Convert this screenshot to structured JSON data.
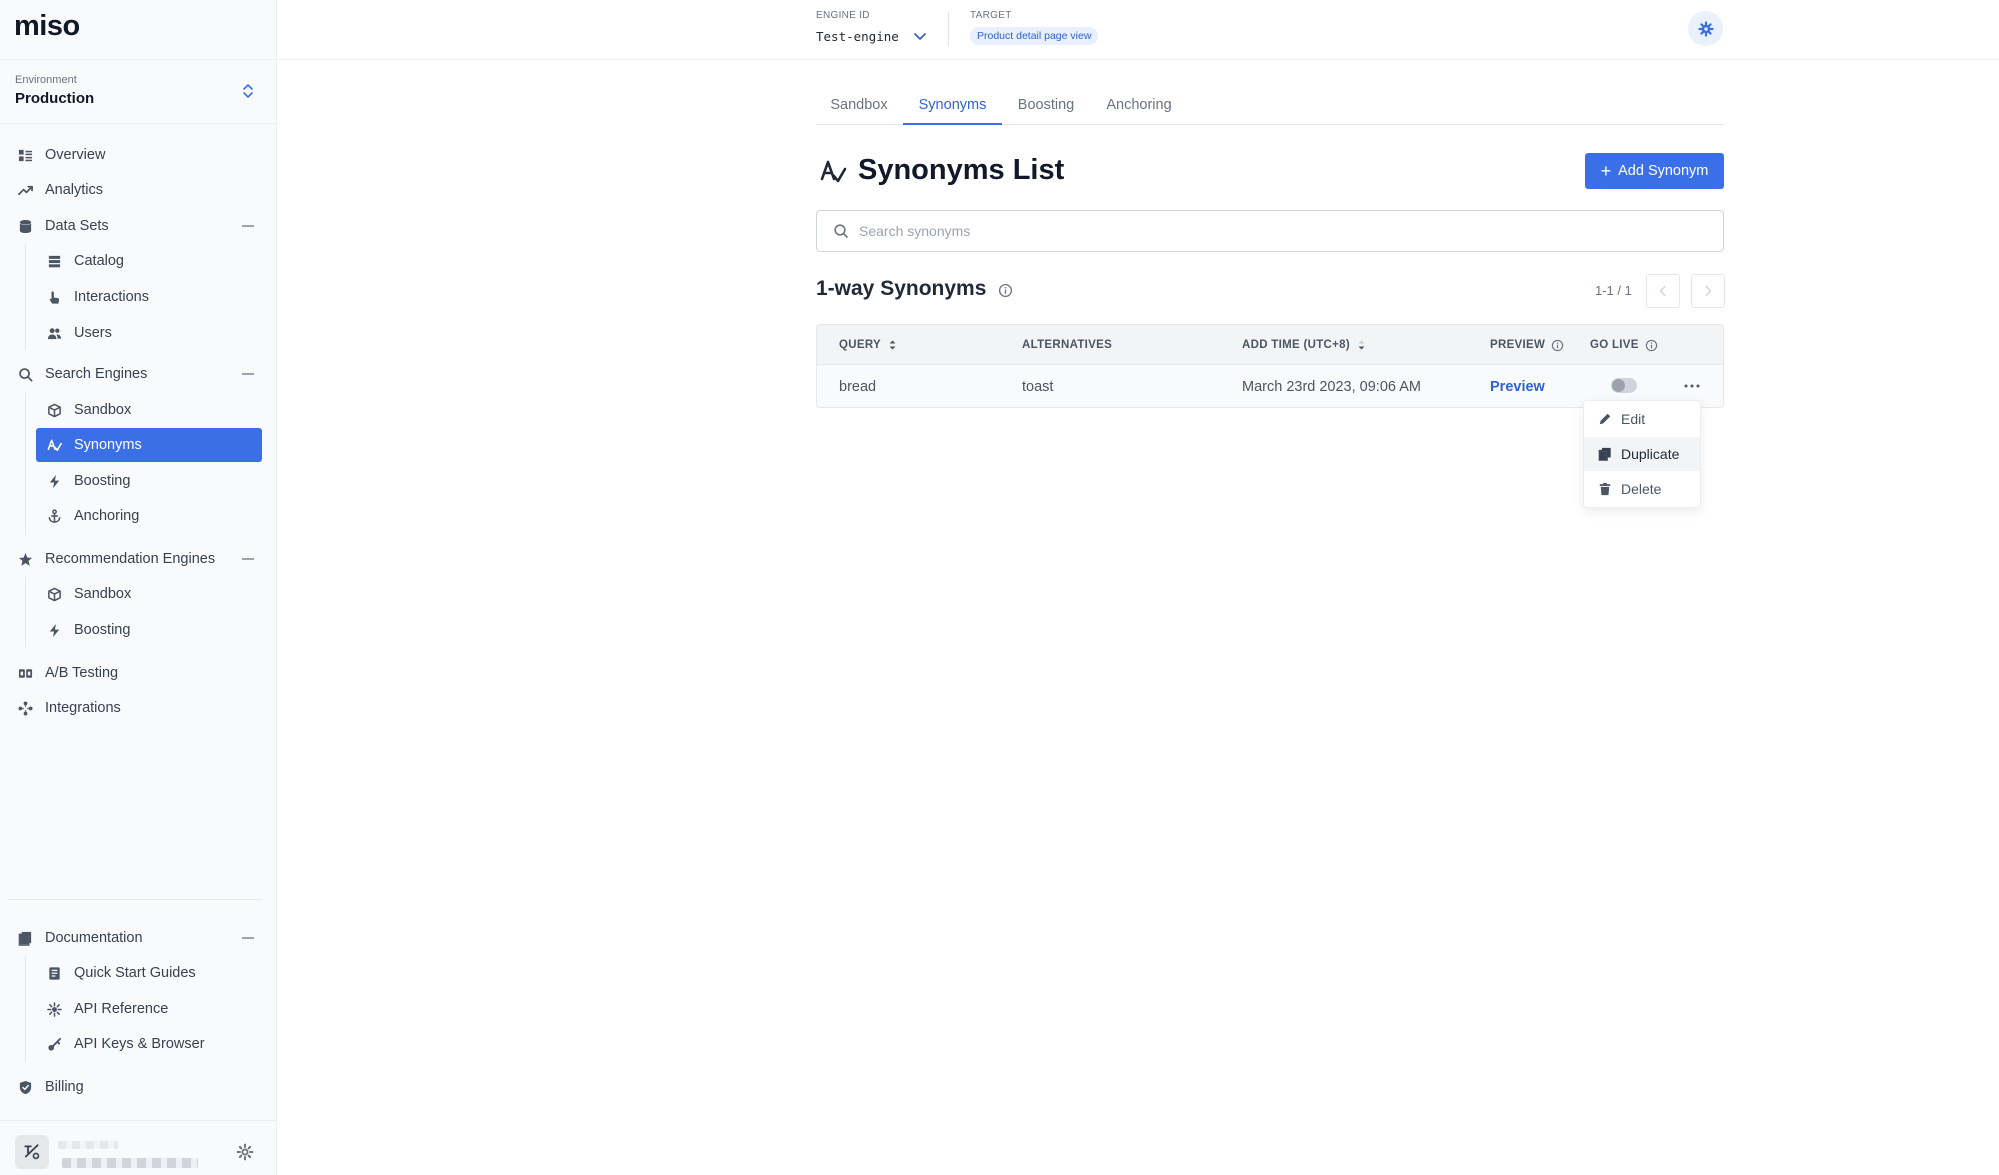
{
  "app": {
    "logo": "miso"
  },
  "environment": {
    "label": "Environment",
    "value": "Production"
  },
  "nav": {
    "overview": "Overview",
    "analytics": "Analytics",
    "data_sets": "Data Sets",
    "catalog": "Catalog",
    "interactions": "Interactions",
    "users": "Users",
    "search_engines": "Search Engines",
    "search_sandbox": "Sandbox",
    "synonyms": "Synonyms",
    "search_boosting": "Boosting",
    "anchoring": "Anchoring",
    "recommendation_engines": "Recommendation Engines",
    "rec_sandbox": "Sandbox",
    "rec_boosting": "Boosting",
    "ab_testing": "A/B Testing",
    "integrations": "Integrations",
    "documentation": "Documentation",
    "quick_start": "Quick Start Guides",
    "api_reference": "API Reference",
    "api_keys": "API Keys & Browser",
    "billing": "Billing"
  },
  "topbar": {
    "engine_label": "ENGINE ID",
    "engine_value": "Test-engine",
    "target_label": "TARGET",
    "target_value": "Product detail page view"
  },
  "tabs": [
    "Sandbox",
    "Synonyms",
    "Boosting",
    "Anchoring"
  ],
  "active_tab": "Synonyms",
  "page": {
    "title": "Synonyms List",
    "add_button": "Add Synonym",
    "search_placeholder": "Search synonyms",
    "section_title": "1-way Synonyms",
    "pager": "1-1 / 1"
  },
  "table": {
    "headers": {
      "query": "QUERY",
      "alternatives": "ALTERNATIVES",
      "add_time": "ADD TIME (UTC+8)",
      "preview": "PREVIEW",
      "go_live": "GO LIVE"
    },
    "rows": [
      {
        "query": "bread",
        "alternatives": "toast",
        "add_time": "March 23rd 2023, 09:06 AM",
        "preview": "Preview",
        "go_live": false
      }
    ]
  },
  "row_menu": {
    "edit": "Edit",
    "duplicate": "Duplicate",
    "delete": "Delete"
  },
  "colors": {
    "accent": "#3b6fe8",
    "accent_text": "#2f62d8",
    "sidebar_bg": "#f9fafb"
  },
  "icons": {
    "overview": "grid-list-icon",
    "analytics": "trend-up-icon",
    "data_sets": "database-icon",
    "catalog": "stack-icon",
    "interactions": "pointer-hand-icon",
    "users": "users-icon",
    "search": "search-icon",
    "sandbox": "cube-icon",
    "synonyms": "synonym-icon",
    "boosting": "bolt-icon",
    "anchoring": "anchor-icon",
    "recommendation": "star-icon",
    "ab_testing": "ab-icon",
    "integrations": "integration-icon",
    "documentation": "docs-icon",
    "quick_start": "book-icon",
    "api_reference": "api-icon",
    "api_keys": "key-icon",
    "billing": "billing-shield-icon",
    "settings": "gear-icon"
  }
}
